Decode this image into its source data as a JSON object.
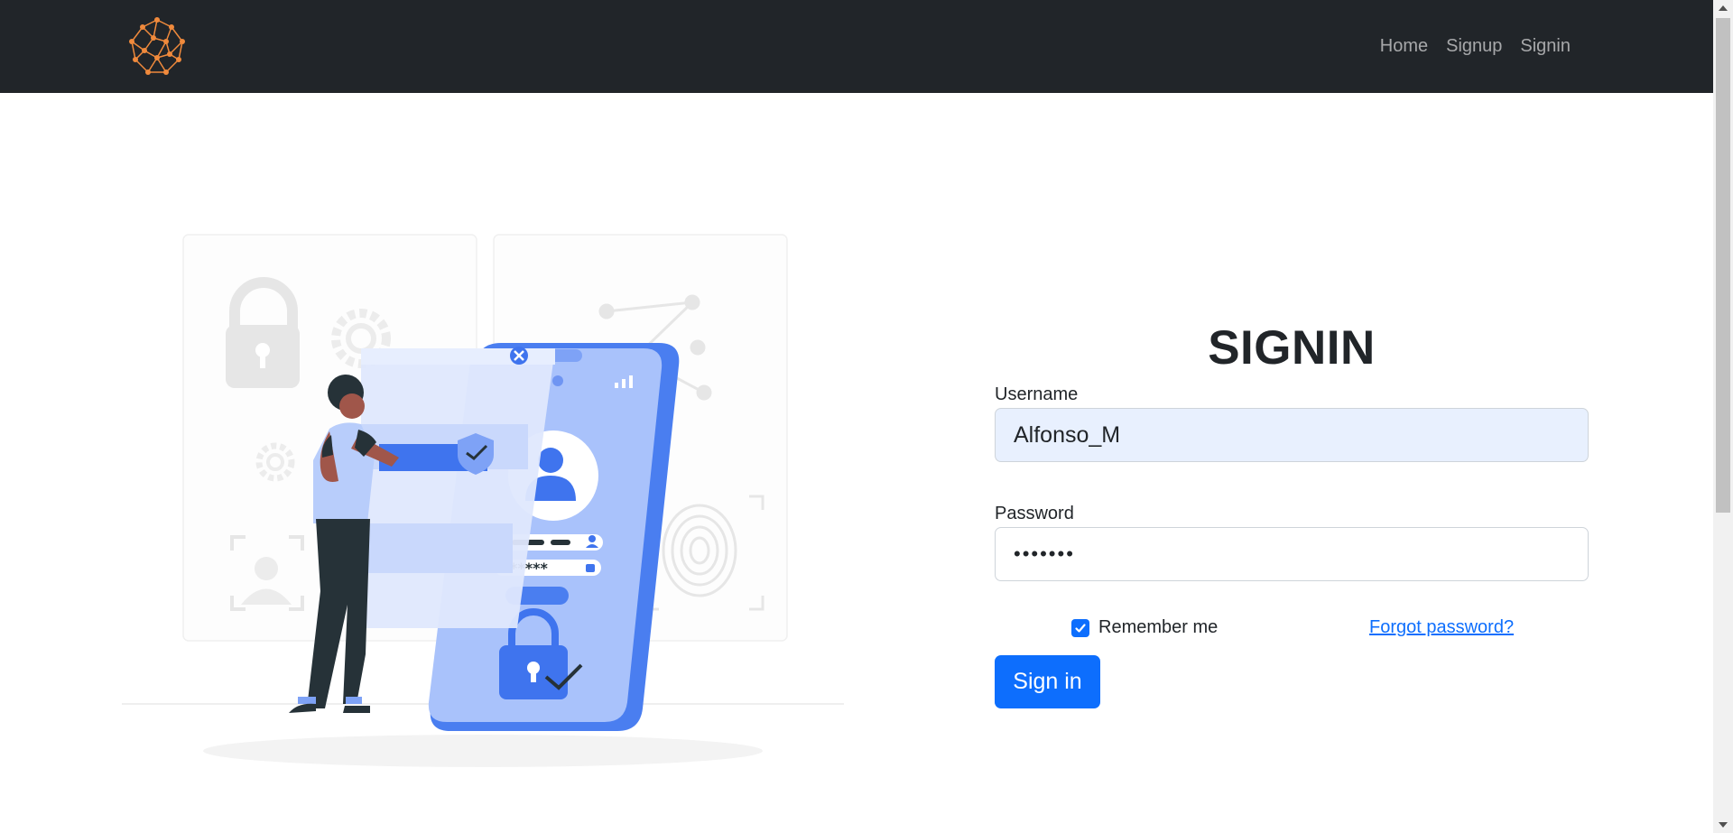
{
  "navbar": {
    "logo_icon": "network-brain-logo",
    "links": [
      "Home",
      "Signup",
      "Signin"
    ]
  },
  "illustration": {
    "icon": "mobile-login-security-illustration"
  },
  "form": {
    "title": "SIGNIN",
    "username_label": "Username",
    "username_value": "Alfonso_M",
    "password_label": "Password",
    "password_value": "•••••••",
    "remember_label": "Remember me",
    "remember_checked": true,
    "forgot_label": "Forgot password?",
    "submit_label": "Sign in"
  },
  "colors": {
    "navbar_bg": "#212529",
    "accent": "#0d6efd",
    "logo": "#f08a3c",
    "autofill_bg": "#e8f0fe"
  }
}
